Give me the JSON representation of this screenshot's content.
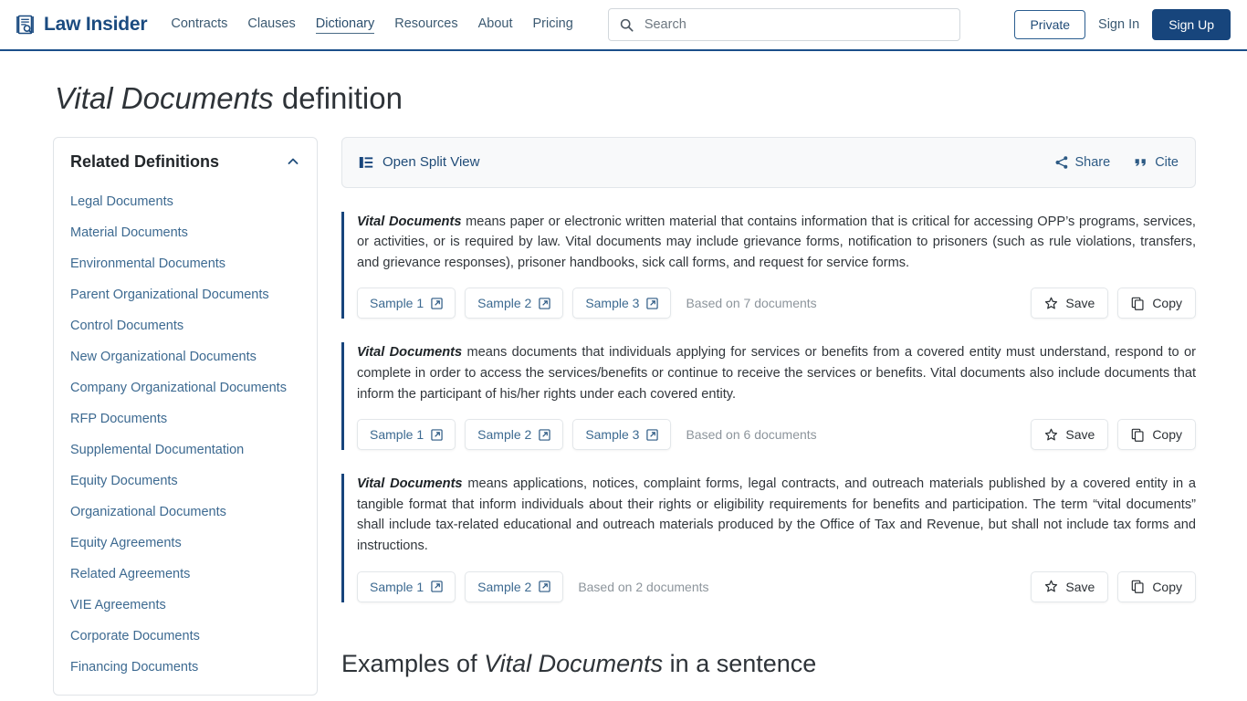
{
  "header": {
    "brand": "Law Insider",
    "brand_icon": "document-search-icon",
    "nav": [
      {
        "label": "Contracts",
        "active": false
      },
      {
        "label": "Clauses",
        "active": false
      },
      {
        "label": "Dictionary",
        "active": true
      },
      {
        "label": "Resources",
        "active": false
      },
      {
        "label": "About",
        "active": false
      },
      {
        "label": "Pricing",
        "active": false
      }
    ],
    "search": {
      "placeholder": "Search",
      "value": "",
      "icon": "search-icon"
    },
    "private_label": "Private",
    "signin_label": "Sign In",
    "signup_label": "Sign Up"
  },
  "page": {
    "title_term": "Vital Documents",
    "title_suffix": " definition"
  },
  "sidebar": {
    "heading": "Related Definitions",
    "collapse_icon": "chevron-up-icon",
    "items": [
      {
        "label": "Legal Documents"
      },
      {
        "label": "Material Documents"
      },
      {
        "label": "Environmental Documents"
      },
      {
        "label": "Parent Organizational Documents"
      },
      {
        "label": "Control Documents"
      },
      {
        "label": "New Organizational Documents"
      },
      {
        "label": "Company Organizational Documents"
      },
      {
        "label": "RFP Documents"
      },
      {
        "label": "Supplemental Documentation"
      },
      {
        "label": "Equity Documents"
      },
      {
        "label": "Organizational Documents"
      },
      {
        "label": "Equity Agreements"
      },
      {
        "label": "Related Agreements"
      },
      {
        "label": "VIE Agreements"
      },
      {
        "label": "Corporate Documents"
      },
      {
        "label": "Financing Documents"
      }
    ]
  },
  "toolbar": {
    "split_view_label": "Open Split View",
    "split_view_icon": "split-view-icon",
    "share_label": "Share",
    "share_icon": "share-icon",
    "cite_label": "Cite",
    "cite_icon": "quote-icon"
  },
  "definitions": [
    {
      "term": "Vital Documents",
      "body": " means paper or electronic written material that contains information that is critical for accessing OPP’s programs, services, or activities, or is required by law. Vital documents may include grievance forms, notification to prisoners (such as rule violations, transfers, and grievance responses), prisoner handbooks, sick call forms, and request for service forms.",
      "samples": [
        "Sample 1",
        "Sample 2",
        "Sample 3"
      ],
      "based_on": "Based on 7 documents",
      "save_label": "Save",
      "copy_label": "Copy"
    },
    {
      "term": "Vital Documents",
      "body": " means documents that individuals applying for services or benefits from a covered entity must understand, respond to or complete in order to access the services/benefits or continue to receive the services or benefits. Vital documents also include documents that inform the participant of his/her rights under each covered entity.",
      "samples": [
        "Sample 1",
        "Sample 2",
        "Sample 3"
      ],
      "based_on": "Based on 6 documents",
      "save_label": "Save",
      "copy_label": "Copy"
    },
    {
      "term": "Vital Documents",
      "body": " means applications, notices, complaint forms, legal contracts, and outreach materials published by a covered entity in a tangible format that inform individuals about their rights or eligibility requirements for benefits and participation. The term “vital documents” shall include tax-related educational and outreach materials produced by the Office of Tax and Revenue, but shall not include tax forms and instructions.",
      "samples": [
        "Sample 1",
        "Sample 2"
      ],
      "based_on": "Based on 2 documents",
      "save_label": "Save",
      "copy_label": "Copy"
    }
  ],
  "examples": {
    "prefix": "Examples of ",
    "term": "Vital Documents",
    "suffix": " in a sentence"
  },
  "colors": {
    "brand_navy": "#1b4b80",
    "accent_bar": "#17457c",
    "link_blue": "#3d6a91",
    "signup_bg": "#17457c",
    "muted_text": "#8d959c"
  }
}
